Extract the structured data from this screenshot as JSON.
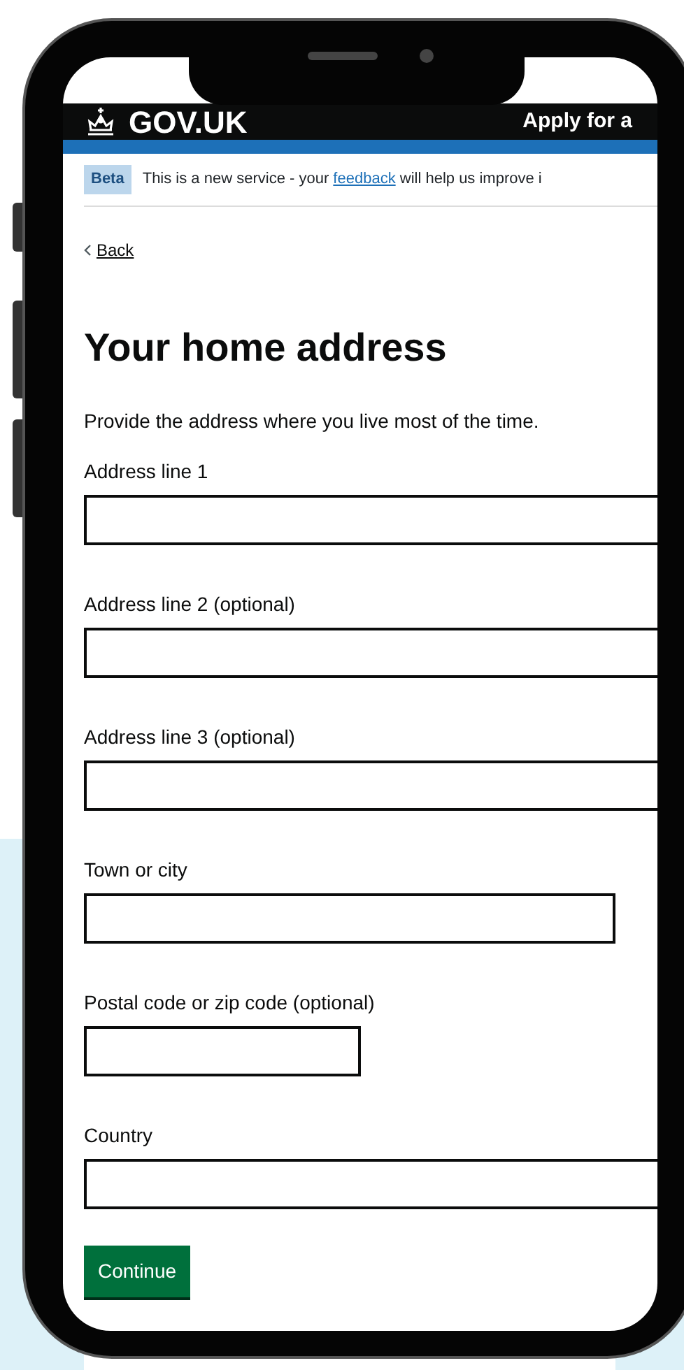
{
  "header": {
    "logo": "GOV.UK",
    "service_name": "Apply for a"
  },
  "phase_banner": {
    "tag": "Beta",
    "text_before": "This is a new service - your",
    "link": "feedback",
    "text_after": "will help us improve i"
  },
  "back_link": "Back",
  "heading": "Your home address",
  "hint": "Provide the address where you live most of the time.",
  "fields": [
    {
      "label": "Address line 1",
      "kind": "wide"
    },
    {
      "label": "Address line 2 (optional)",
      "kind": "wide"
    },
    {
      "label": "Address line 3 (optional)",
      "kind": "wide"
    },
    {
      "label": "Town or city",
      "kind": "medium"
    },
    {
      "label": "Postal code or zip code (optional)",
      "kind": "narrow"
    },
    {
      "label": "Country",
      "kind": "wide"
    }
  ],
  "button": "Continue"
}
